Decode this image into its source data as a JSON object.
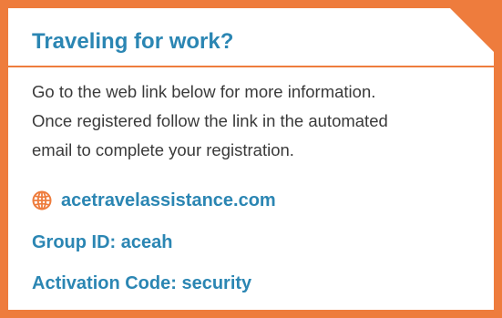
{
  "card": {
    "title": "Traveling for work?",
    "body_lines": [
      "Go to the web link below for more information.",
      "Once registered follow the link in the automated",
      "email to complete your registration."
    ],
    "link": {
      "icon": "globe-icon",
      "text": "acetravelassistance.com"
    },
    "group_id": "Group ID: aceah",
    "activation_code": "Activation Code: security"
  },
  "colors": {
    "accent_orange": "#ee7c3d",
    "heading_blue": "#2b86b3",
    "body_text": "#3a3a3a",
    "background": "#ffffff"
  }
}
